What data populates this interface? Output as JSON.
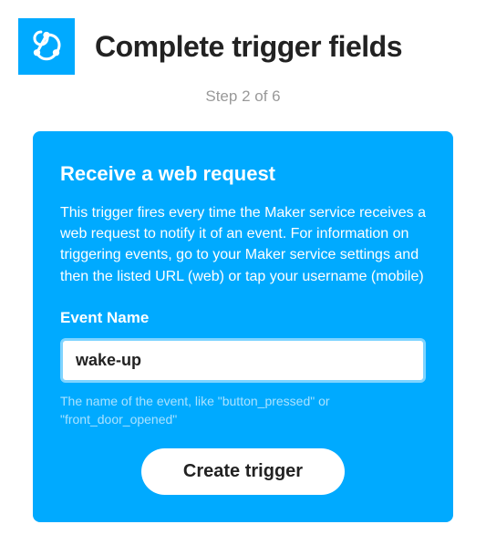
{
  "header": {
    "title": "Complete trigger fields",
    "step": "Step 2 of 6"
  },
  "card": {
    "title": "Receive a web request",
    "description": "This trigger fires every time the Maker service receives a web request to notify it of an event. For information on triggering events, go to your Maker service settings and then the listed URL (web) or tap your username (mobile)",
    "field_label": "Event Name",
    "field_value": "wake-up",
    "field_hint": "The name of the event, like \"button_pressed\" or \"front_door_opened\"",
    "submit_label": "Create trigger"
  }
}
